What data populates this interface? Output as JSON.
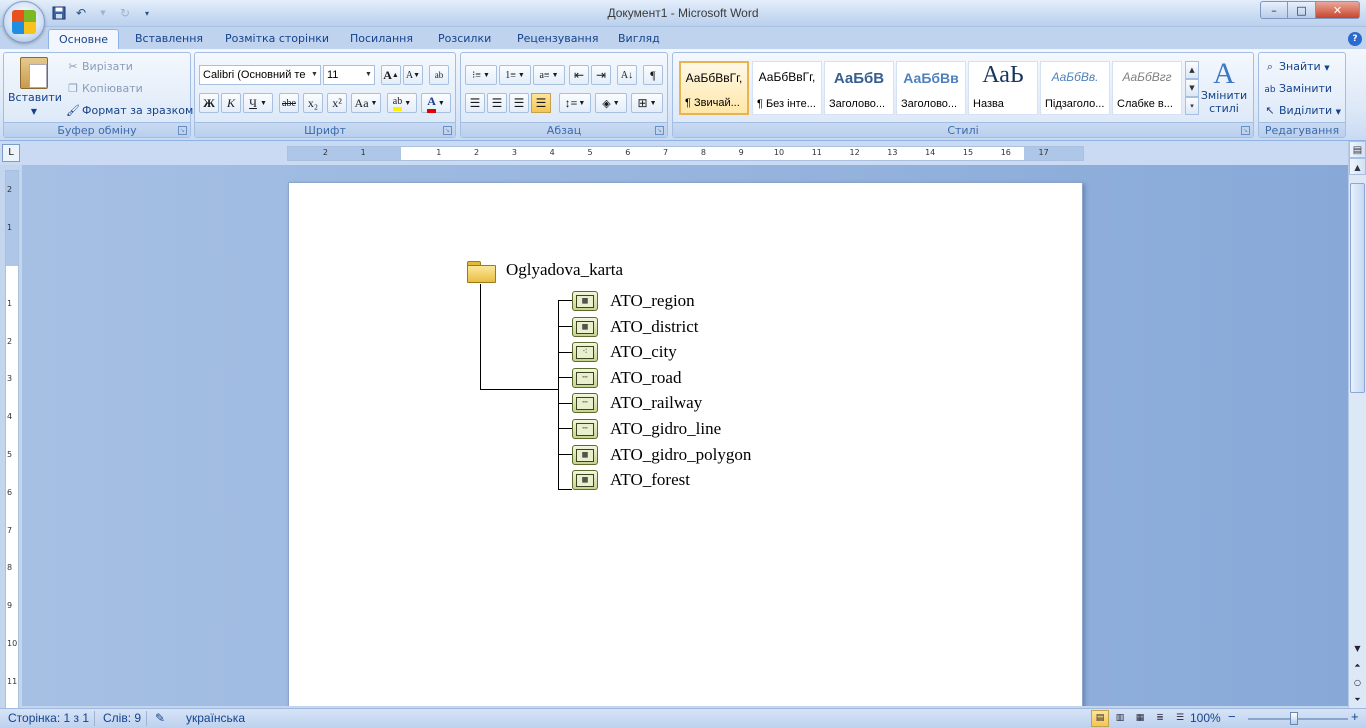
{
  "window": {
    "title": "Документ1 - Microsoft Word",
    "minimize": "–",
    "maximize": "□",
    "close": "✕"
  },
  "qat": {
    "save_icon": "save-icon",
    "undo_icon": "undo-icon",
    "redo_icon": "redo-icon",
    "customize_icon": "dropdown-icon"
  },
  "tabs": [
    "Основне",
    "Вставлення",
    "Розмітка сторінки",
    "Посилання",
    "Розсилки",
    "Рецензування",
    "Вигляд"
  ],
  "active_tab": "Основне",
  "clipboard": {
    "label": "Буфер обміну",
    "paste": "Вставити",
    "cut": "Вирізати",
    "copy": "Копіювати",
    "format_painter": "Формат за зразком"
  },
  "font": {
    "label": "Шрифт",
    "family": "Calibri (Основний те",
    "size": "11",
    "bold": "Ж",
    "italic": "К",
    "underline": "Ч",
    "strike": "abe",
    "subscript": "x₂",
    "superscript": "x²",
    "change_case": "Aa",
    "grow": "A",
    "shrink": "A",
    "clear": "ab"
  },
  "paragraph": {
    "label": "Абзац",
    "show_marks": "¶"
  },
  "styles": {
    "label": "Стилі",
    "items": [
      {
        "preview": "АаБбВвГг,",
        "name": "¶ Звичай..."
      },
      {
        "preview": "АаБбВвГг,",
        "name": "¶ Без інте..."
      },
      {
        "preview": "АаБбВ",
        "name": "Заголово..."
      },
      {
        "preview": "АаБбВв",
        "name": "Заголово..."
      },
      {
        "preview": "АаЬ",
        "name": "Назва"
      },
      {
        "preview": "АаБбВв.",
        "name": "Підзаголо..."
      },
      {
        "preview": "АаБбВгг",
        "name": "Слабке в..."
      }
    ],
    "change_styles": "Змінити стилі",
    "accent": "#e9b351"
  },
  "editing": {
    "label": "Редагування",
    "find": "Знайти",
    "replace": "Замінити",
    "select": "Виділити"
  },
  "ruler": {
    "h_numbers": [
      "3",
      "2",
      "1",
      "1",
      "2",
      "3",
      "4",
      "5",
      "6",
      "7",
      "8",
      "9",
      "10",
      "11",
      "12",
      "13",
      "14",
      "15",
      "16",
      "17"
    ],
    "v_numbers": [
      "2",
      "1",
      "1",
      "2",
      "3",
      "4",
      "5",
      "6",
      "7",
      "8",
      "9",
      "10",
      "11"
    ]
  },
  "tree": {
    "root": "Oglyadova_karta",
    "children": [
      {
        "label": "ATO_region",
        "icon": "polygon-layer-icon",
        "glyph": "▦"
      },
      {
        "label": "ATO_district",
        "icon": "polygon-layer-icon",
        "glyph": "▦"
      },
      {
        "label": "ATO_city",
        "icon": "point-layer-icon",
        "glyph": "⁖"
      },
      {
        "label": "ATO_road",
        "icon": "line-layer-icon",
        "glyph": "╌"
      },
      {
        "label": "ATO_railway",
        "icon": "line-layer-icon",
        "glyph": "╌"
      },
      {
        "label": "ATO_gidro_line",
        "icon": "line-layer-icon",
        "glyph": "╌"
      },
      {
        "label": "ATO_gidro_polygon",
        "icon": "polygon-layer-icon",
        "glyph": "▦"
      },
      {
        "label": "ATO_forest",
        "icon": "polygon-layer-icon",
        "glyph": "▦"
      }
    ]
  },
  "status": {
    "page": "Сторінка: 1 з 1",
    "words": "Слів: 9",
    "language": "українська",
    "zoom": "100%",
    "zoom_minus": "−",
    "zoom_plus": "+"
  }
}
